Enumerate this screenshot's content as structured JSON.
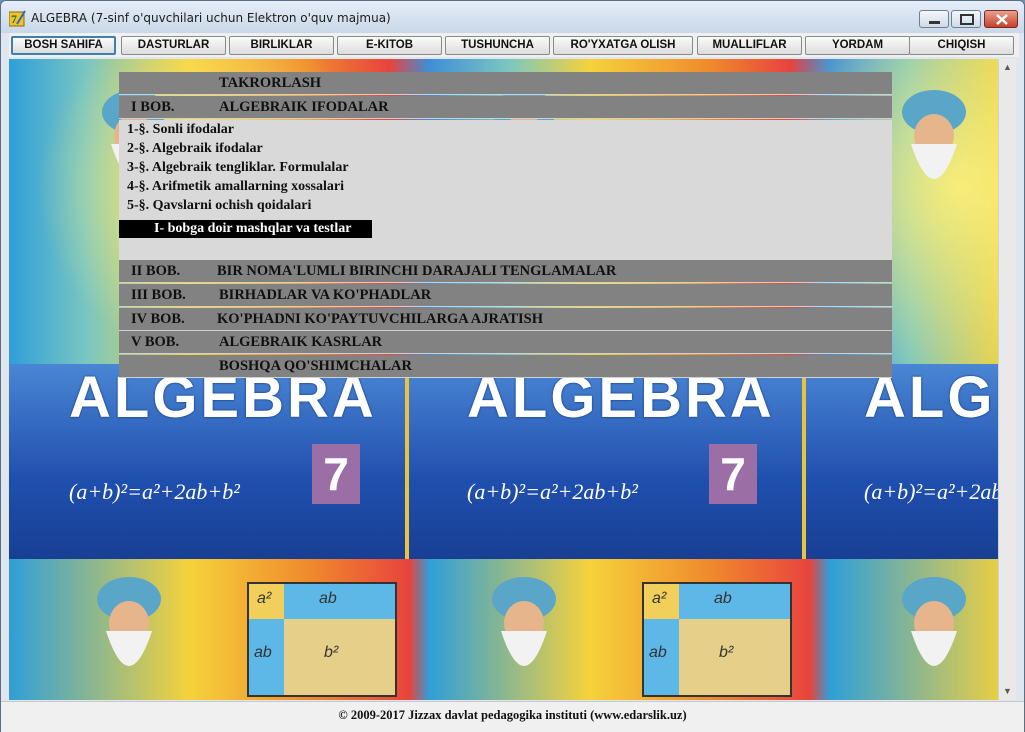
{
  "window": {
    "title": "ALGEBRA (7-sinf o'quvchilari uchun Elektron o'quv majmua)",
    "icon": "algebra-app-icon"
  },
  "nav": {
    "buttons": [
      {
        "label": "BOSH SAHIFA",
        "active": true
      },
      {
        "label": "DASTURLAR"
      },
      {
        "label": "BIRLIKLAR"
      },
      {
        "label": "E-KITOB"
      },
      {
        "label": "TUSHUNCHA"
      },
      {
        "label": "RO'YXATGA OLISH"
      },
      {
        "label": "MUALLIFLAR"
      },
      {
        "label": "YORDAM"
      },
      {
        "label": "CHIQISH"
      }
    ]
  },
  "background": {
    "title_word": "ALGEBRA",
    "formula": "(a+b)²=a²+2ab+b²",
    "grade": "7",
    "square_labels": [
      "a²",
      "ab",
      "ab",
      "b²"
    ]
  },
  "menu": {
    "rows": [
      {
        "code": "",
        "text": "TAKRORLASH"
      },
      {
        "code": "I  BOB.",
        "text": "ALGEBRAIK IFODALAR"
      },
      {
        "code": "II  BOB.",
        "text": "BIR NOMA'LUMLI BIRINCHI DARAJALI TENGLAMALAR"
      },
      {
        "code": "III  BOB.",
        "text": "BIRHADLAR VA KO'PHADLAR"
      },
      {
        "code": "IV  BOB.",
        "text": "KO'PHADNI KO'PAYTUVCHILARGA AJRATISH"
      },
      {
        "code": "V  BOB.",
        "text": "ALGEBRAIK KASRLAR"
      },
      {
        "code": "",
        "text": "BOSHQA QO'SHIMCHALAR"
      }
    ],
    "subitems": [
      "1-§. Sonli ifodalar",
      "2-§. Algebraik ifodalar",
      "3-§. Algebraik tengliklar. Formulalar",
      "4-§. Arifmetik amallarning xossalari",
      "5-§. Qavslarni ochish qoidalari"
    ],
    "highlight": "I- bobga doir mashqlar va testlar"
  },
  "status": {
    "text": "© 2009-2017 Jizzax davlat pedagogika instituti    (www.edarslik.uz)"
  }
}
